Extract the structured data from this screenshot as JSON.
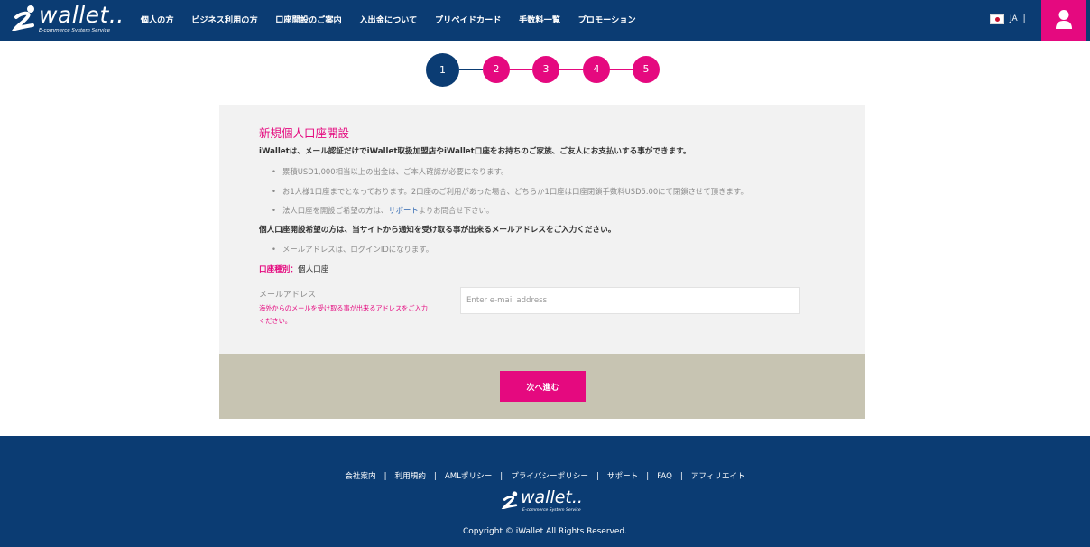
{
  "brand": {
    "logo_text": "wallet..",
    "tagline": "E-commerce System Service"
  },
  "nav": {
    "items": [
      "個人の方",
      "ビジネス利用の方",
      "口座開設のご案内",
      "入出金について",
      "プリペイドカード",
      "手数料一覧",
      "プロモーション"
    ]
  },
  "header": {
    "lang_code": "JA",
    "lang_separator": "|"
  },
  "steps": {
    "labels": [
      "1",
      "2",
      "3",
      "4",
      "5"
    ],
    "current": 1
  },
  "form": {
    "title": "新規個人口座開設",
    "lead": "iWalletは、メール認証だけでiWallet取扱加盟店やiWallet口座をお持ちのご家族、ご友人にお支払いする事ができます。",
    "bullets": [
      "累積USD1,000相当以上の出金は、ご本人確認が必要になります。",
      "お1人様1口座までとなっております。2口座のご利用があった場合、どちらか1口座は口座閉鎖手数料USD5.00にて閉鎖させて頂きます。"
    ],
    "bullet3_before": "法人口座を開設ご希望の方は、",
    "bullet3_link": "サポート",
    "bullet3_after": "よりお問合せ下さい。",
    "lead2": "個人口座開設希望の方は、当サイトから通知を受け取る事が出来るメールアドレスをご入力ください。",
    "bullet4": "メールアドレスは、ログインIDになります。",
    "account_type_label": "口座種別：",
    "account_type_value": "個人口座",
    "email_label": "メールアドレス",
    "email_note": "海外からのメールを受け取る事が出来るアドレスをご入力ください。",
    "email_placeholder": "Enter e-mail address",
    "email_value": "",
    "next_button": "次へ進む"
  },
  "footer": {
    "links": [
      "会社案内",
      "利用規約",
      "AMLポリシー",
      "プライバシーポリシー",
      "サポート",
      "FAQ",
      "アフィリエイト"
    ],
    "separator": "|",
    "logo_text": "wallet..",
    "tagline": "E-commerce System Service",
    "copyright": "Copyright © iWallet All Rights Reserved."
  },
  "colors": {
    "brand_navy": "#0b3c73",
    "accent_pink": "#e5097f",
    "panel_gray": "#f2f2f2",
    "action_bar": "#c7c4b2"
  },
  "icons": {
    "brand": "i-wallet-logo-mark",
    "flag": "japan-flag-icon",
    "user": "user-icon"
  }
}
